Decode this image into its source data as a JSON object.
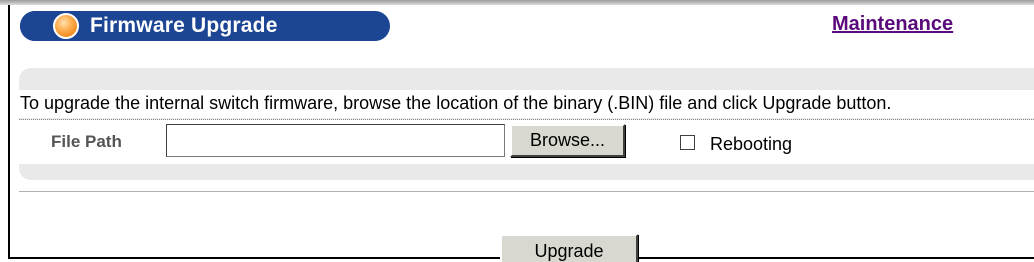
{
  "header": {
    "title": "Firmware Upgrade",
    "link": "Maintenance",
    "accent": "#1c4593",
    "link_color": "#5a0a7a"
  },
  "form": {
    "instruction": "To upgrade the internal switch firmware, browse the location of the binary (.BIN) file and click Upgrade button.",
    "file_path_label": "File Path",
    "file_path_value": "",
    "browse_label": "Browse...",
    "rebooting_label": "Rebooting",
    "rebooting_checked": false,
    "upgrade_label": "Upgrade"
  },
  "icons": {
    "title_orb": "orange-orb-icon"
  }
}
